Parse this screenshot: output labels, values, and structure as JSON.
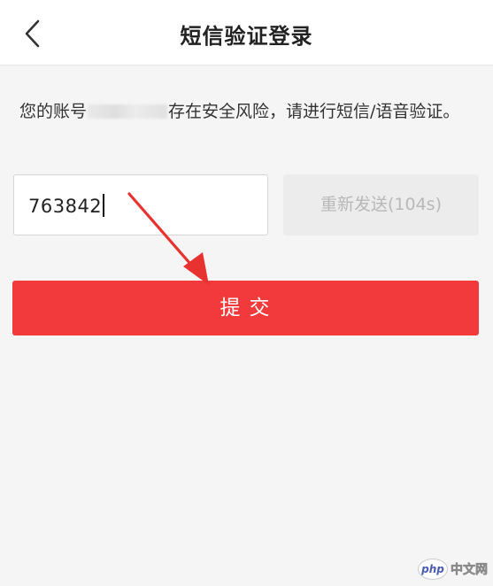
{
  "header": {
    "title": "短信验证登录",
    "back_icon": "chevron-left-icon"
  },
  "notice": {
    "prefix": "您的账号",
    "suffix": "存在安全风险，请进行短信/语音验证。"
  },
  "code_field": {
    "value": "763842"
  },
  "resend": {
    "label": "重新发送(104s)"
  },
  "submit": {
    "label": "提交"
  },
  "watermark": {
    "badge": "php",
    "text": "中文网"
  },
  "colors": {
    "accent": "#f2393c",
    "arrow": "#e8322f",
    "background": "#f5f5f5"
  }
}
